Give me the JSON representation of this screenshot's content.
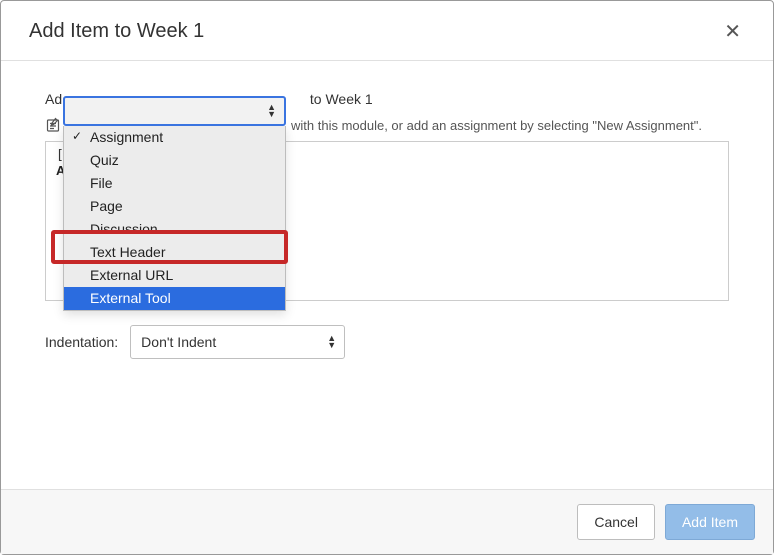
{
  "header": {
    "title": "Add Item to Week 1",
    "close_glyph": "✕"
  },
  "body": {
    "add_prefix": "Ad",
    "add_suffix": "to Week 1",
    "helper_text": "with this module, or add an assignment by selecting \"New Assignment\".",
    "list_placeholder_bracket": "[",
    "list_placeholder_letter": "A"
  },
  "dropdown": {
    "items": [
      {
        "label": "Assignment",
        "selected": true
      },
      {
        "label": "Quiz",
        "selected": false
      },
      {
        "label": "File",
        "selected": false
      },
      {
        "label": "Page",
        "selected": false
      },
      {
        "label": "Discussion",
        "selected": false
      },
      {
        "label": "Text Header",
        "selected": false
      },
      {
        "label": "External URL",
        "selected": false
      },
      {
        "label": "External Tool",
        "selected": false,
        "highlight": true
      }
    ],
    "check_glyph": "✓"
  },
  "indentation": {
    "label": "Indentation:",
    "value": "Don't Indent"
  },
  "footer": {
    "cancel": "Cancel",
    "add": "Add Item"
  }
}
